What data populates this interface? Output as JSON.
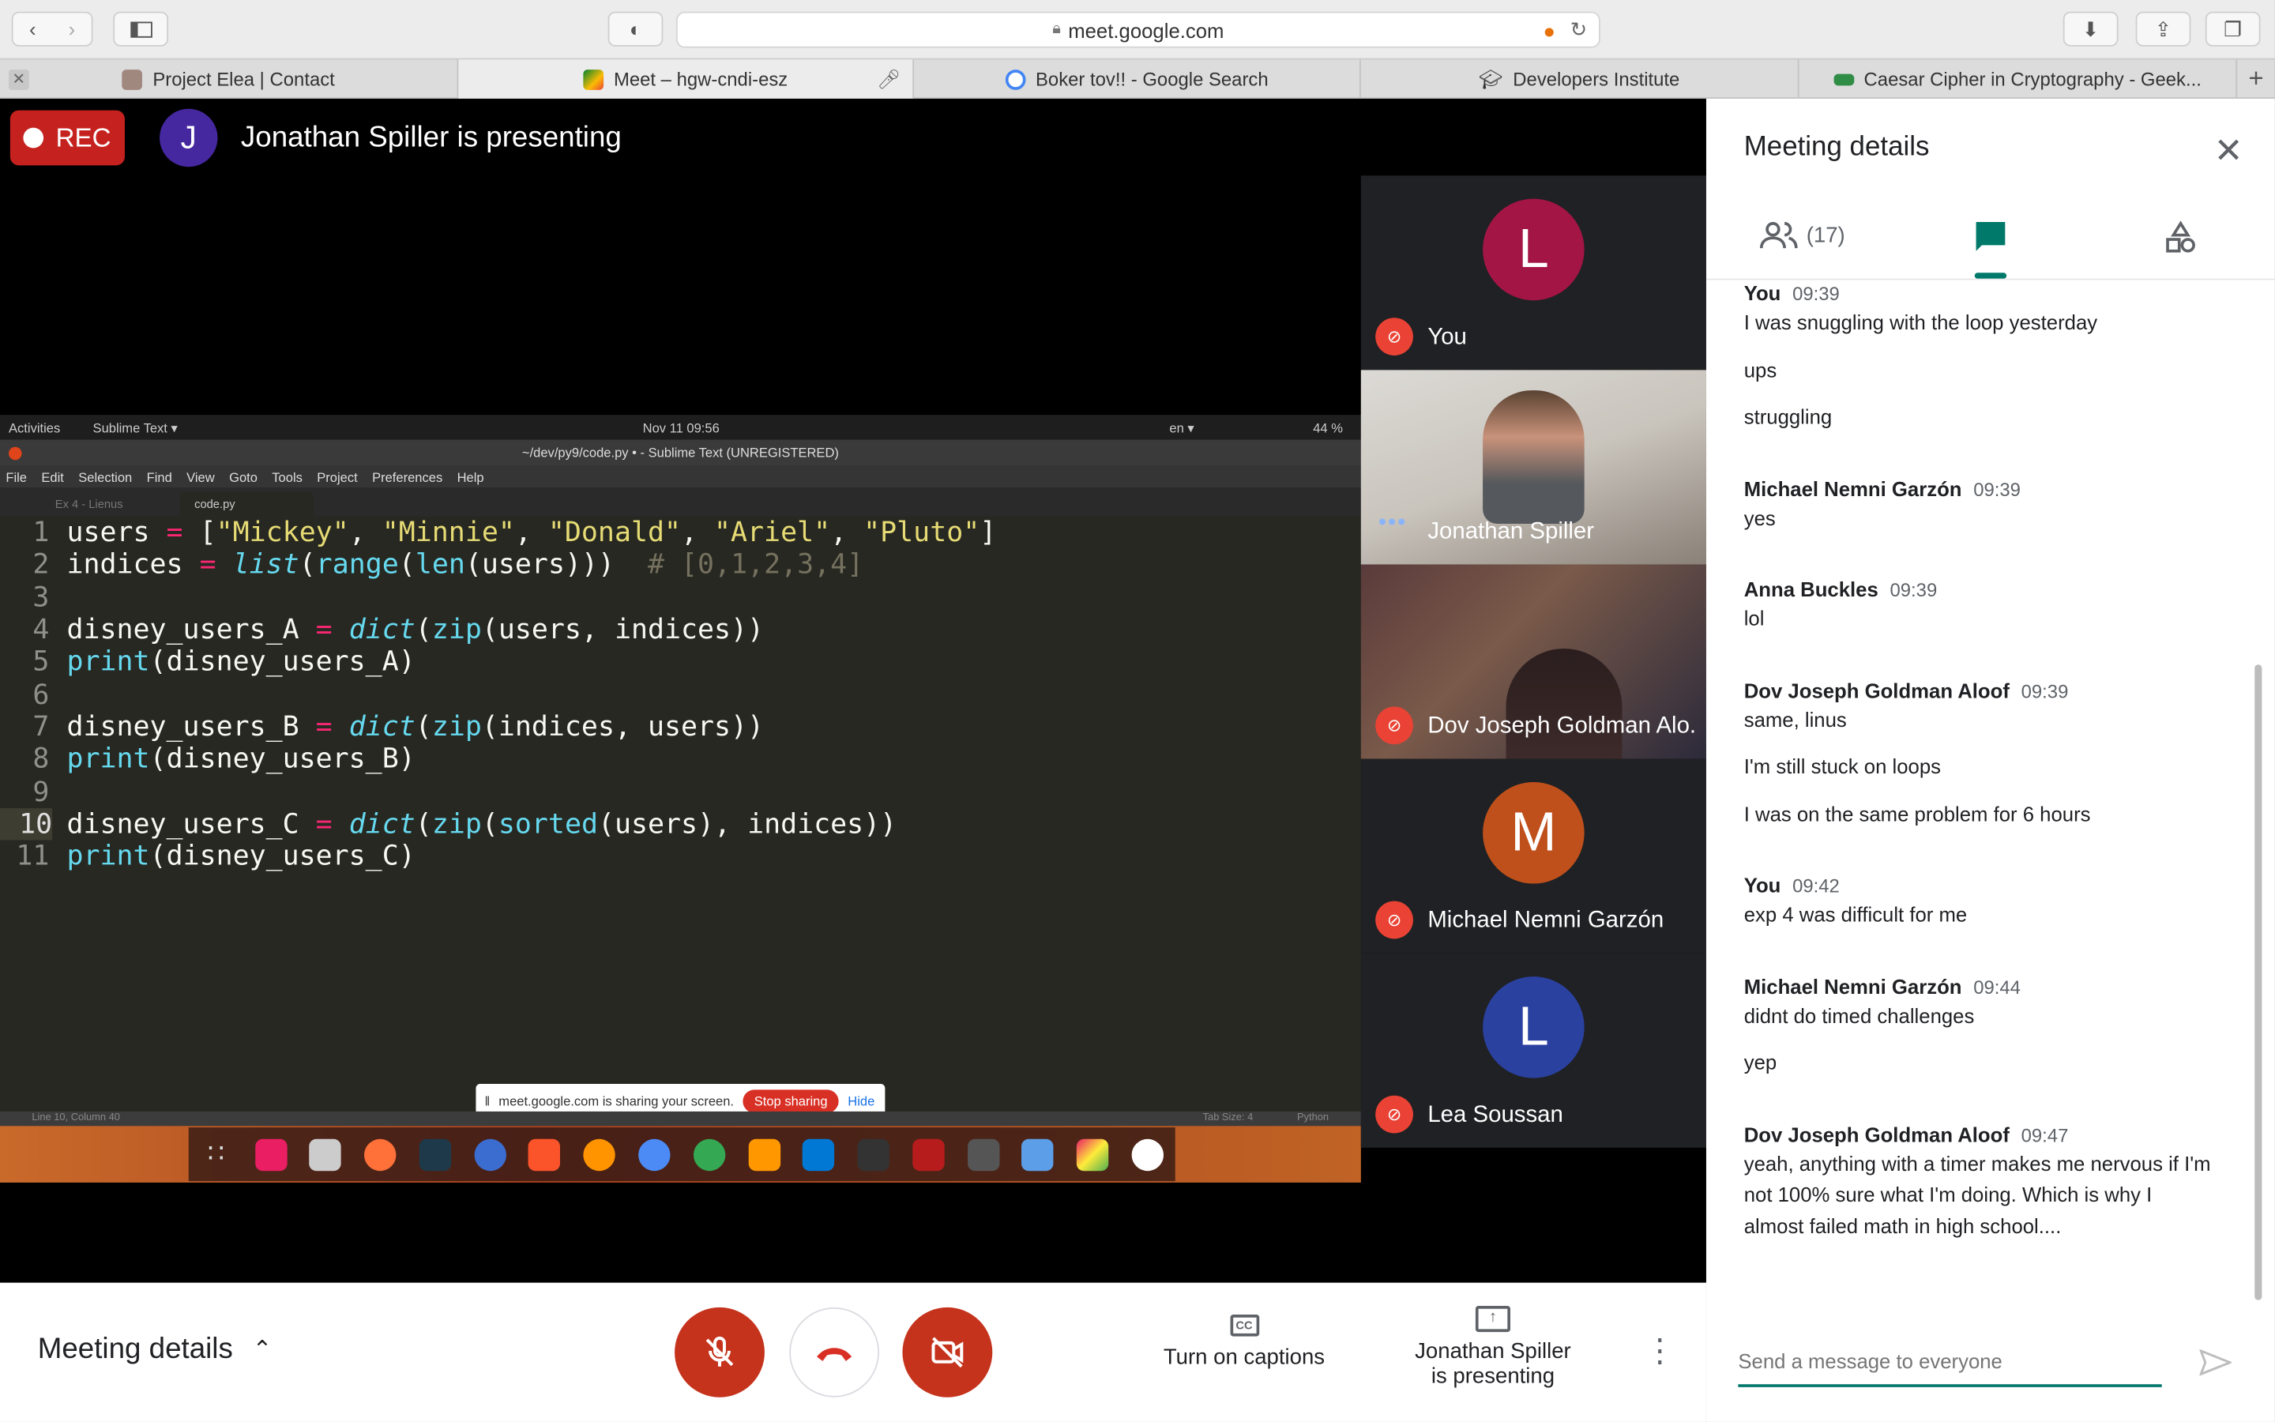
{
  "browser": {
    "url": "meet.google.com",
    "tabs": [
      {
        "label": "Project Elea | Contact",
        "active": false
      },
      {
        "label": "Meet – hgw-cndi-esz",
        "active": true
      },
      {
        "label": "Boker tov!! - Google Search",
        "active": false
      },
      {
        "label": "Developers Institute",
        "active": false
      },
      {
        "label": "Caesar Cipher in Cryptography - Geek...",
        "active": false
      }
    ]
  },
  "meet": {
    "rec_label": "REC",
    "presenter_initial": "J",
    "presenter_text": "Jonathan Spiller is presenting",
    "participants": [
      {
        "name": "You",
        "initial": "L",
        "color": "#a31545"
      },
      {
        "name": "Jonathan Spiller",
        "video": true
      },
      {
        "name": "Dov Joseph Goldman Alo...",
        "video": true
      },
      {
        "name": "Michael Nemni Garzón",
        "initial": "M",
        "color": "#c0501b"
      },
      {
        "name": "Lea Soussan",
        "initial": "L",
        "color": "#2a41a0"
      }
    ]
  },
  "shared_screen": {
    "activities": "Activities",
    "app": "Sublime Text ▾",
    "clock": "Nov 11  09:56",
    "title": "~/dev/py9/code.py • - Sublime Text (UNREGISTERED)",
    "menu": [
      "File",
      "Edit",
      "Selection",
      "Find",
      "View",
      "Goto",
      "Tools",
      "Project",
      "Preferences",
      "Help"
    ],
    "tab_inactive": "Ex 4 - Lienus",
    "tab_active": "code.py",
    "status_left": "Line 10, Column 40",
    "status_tab": "Tab Size: 4",
    "status_lang": "Python",
    "share_text": "meet.google.com is sharing your screen.",
    "stop_sharing": "Stop sharing",
    "hide": "Hide",
    "battery": "44 %",
    "lang": "en ▾"
  },
  "bottom_bar": {
    "meeting_details": "Meeting details",
    "captions": "Turn on captions",
    "presenting_line1": "Jonathan Spiller",
    "presenting_line2": "is presenting"
  },
  "panel": {
    "title": "Meeting details",
    "people_count": "(17)",
    "input_placeholder": "Send a message to everyone",
    "messages": [
      {
        "sender": "You",
        "time": "09:39",
        "lines": [
          "I was snuggling with the loop yesterday",
          "ups",
          "struggling"
        ]
      },
      {
        "sender": "Michael Nemni Garzón",
        "time": "09:39",
        "lines": [
          "yes"
        ]
      },
      {
        "sender": "Anna Buckles",
        "time": "09:39",
        "lines": [
          "lol"
        ]
      },
      {
        "sender": "Dov Joseph Goldman Aloof",
        "time": "09:39",
        "lines": [
          "same, linus",
          "I'm still stuck on loops",
          "I was on the same problem for 6 hours"
        ]
      },
      {
        "sender": "You",
        "time": "09:42",
        "lines": [
          "exp 4 was difficult for me"
        ]
      },
      {
        "sender": "Michael Nemni Garzón",
        "time": "09:44",
        "lines": [
          "didnt do timed challenges",
          "yep"
        ]
      },
      {
        "sender": "Dov Joseph Goldman Aloof",
        "time": "09:47",
        "lines": [
          "yeah, anything with a timer makes me nervous if I'm not 100% sure what I'm doing. Which is why I almost failed math in high school...."
        ]
      }
    ]
  }
}
